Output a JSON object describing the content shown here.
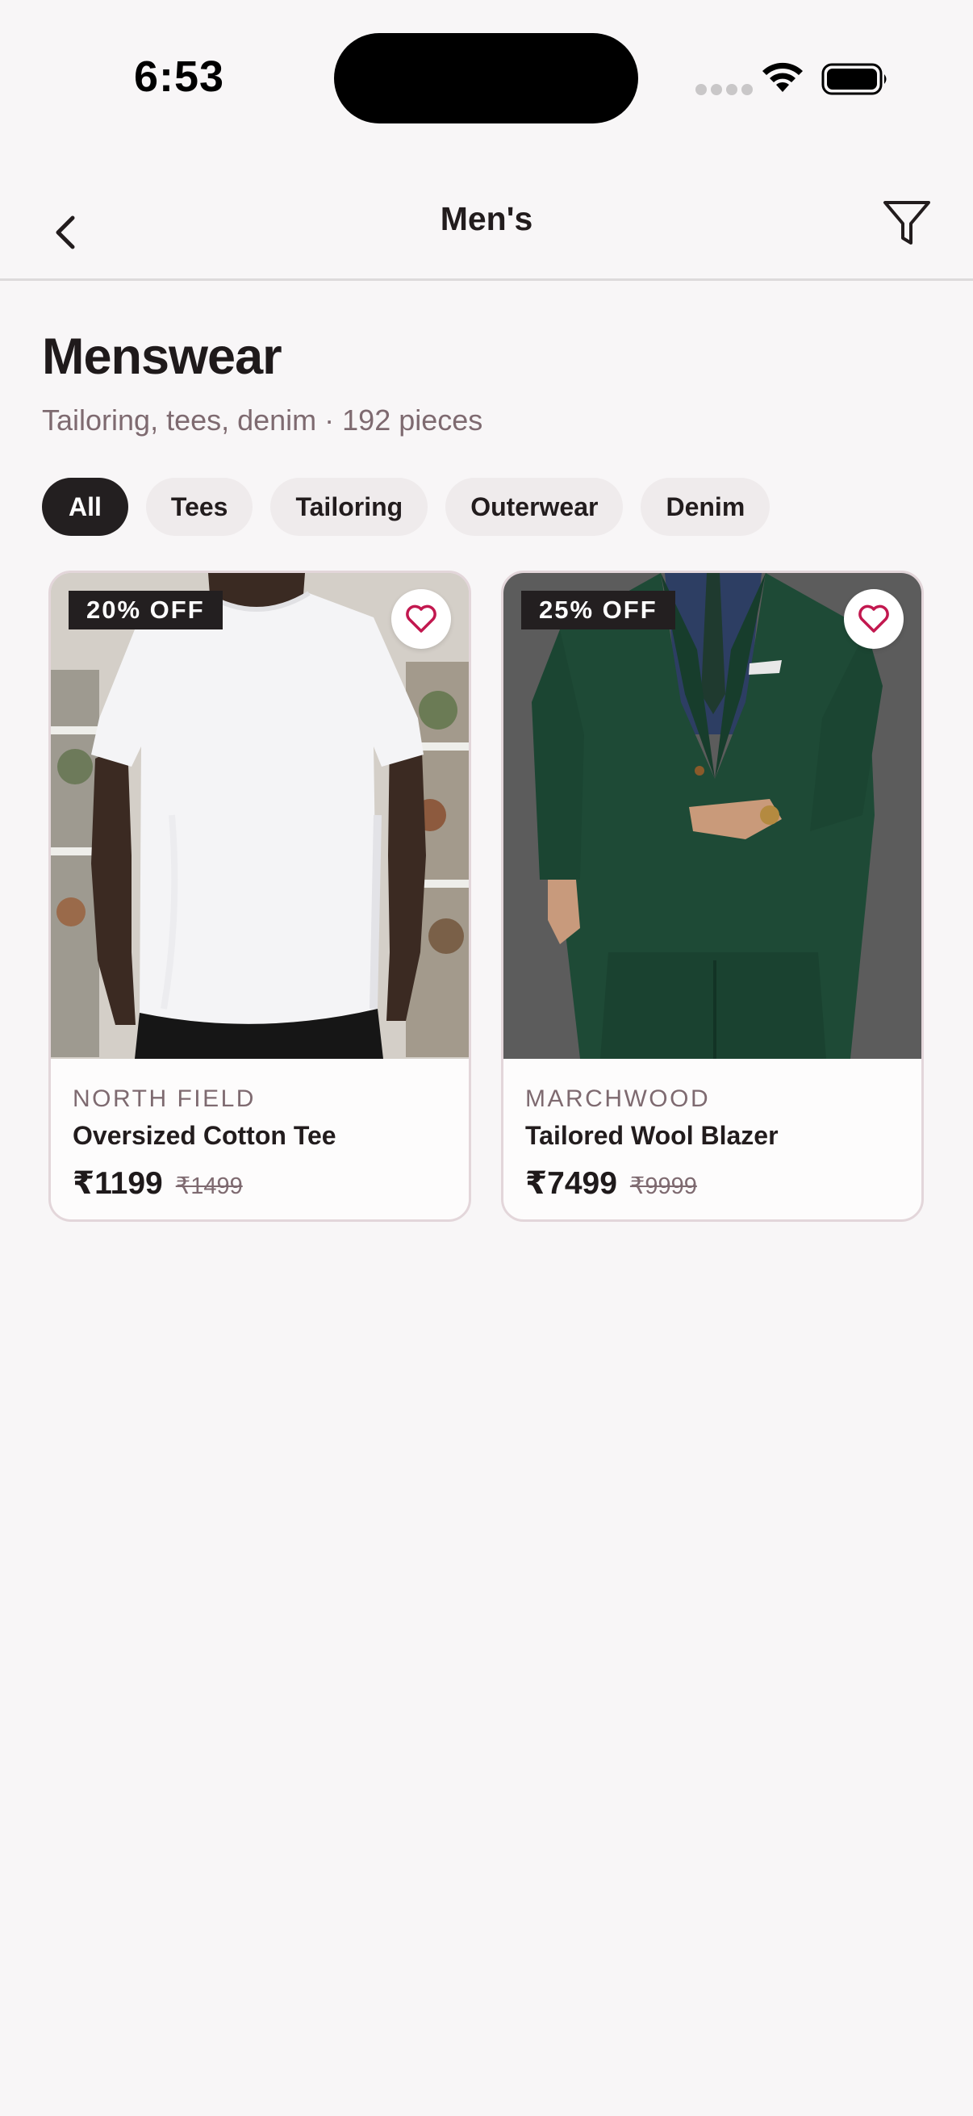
{
  "status_bar": {
    "time": "6:53"
  },
  "nav": {
    "title": "Men's",
    "back_icon": "chevron-left-icon",
    "filter_icon": "filter-icon"
  },
  "header": {
    "title": "Menswear",
    "subtitle": "Tailoring, tees, denim · 192 pieces"
  },
  "chips": [
    {
      "label": "All",
      "active": true
    },
    {
      "label": "Tees",
      "active": false
    },
    {
      "label": "Tailoring",
      "active": false
    },
    {
      "label": "Outerwear",
      "active": false
    },
    {
      "label": "Denim",
      "active": false
    }
  ],
  "products": [
    {
      "badge": "20% OFF",
      "brand": "NORTH FIELD",
      "name": "Oversized Cotton Tee",
      "price": "₹1199",
      "old_price": "₹1499",
      "image": "white-tshirt-photo"
    },
    {
      "badge": "25% OFF",
      "brand": "MARCHWOOD",
      "name": "Tailored Wool Blazer",
      "price": "₹7499",
      "old_price": "₹9999",
      "image": "green-suit-photo"
    }
  ],
  "colors": {
    "background": "#f8f6f7",
    "chip_active": "#231f20",
    "chip_inactive": "#efebec",
    "accent_heart": "#c2184f",
    "muted_text": "#7e6a70"
  }
}
